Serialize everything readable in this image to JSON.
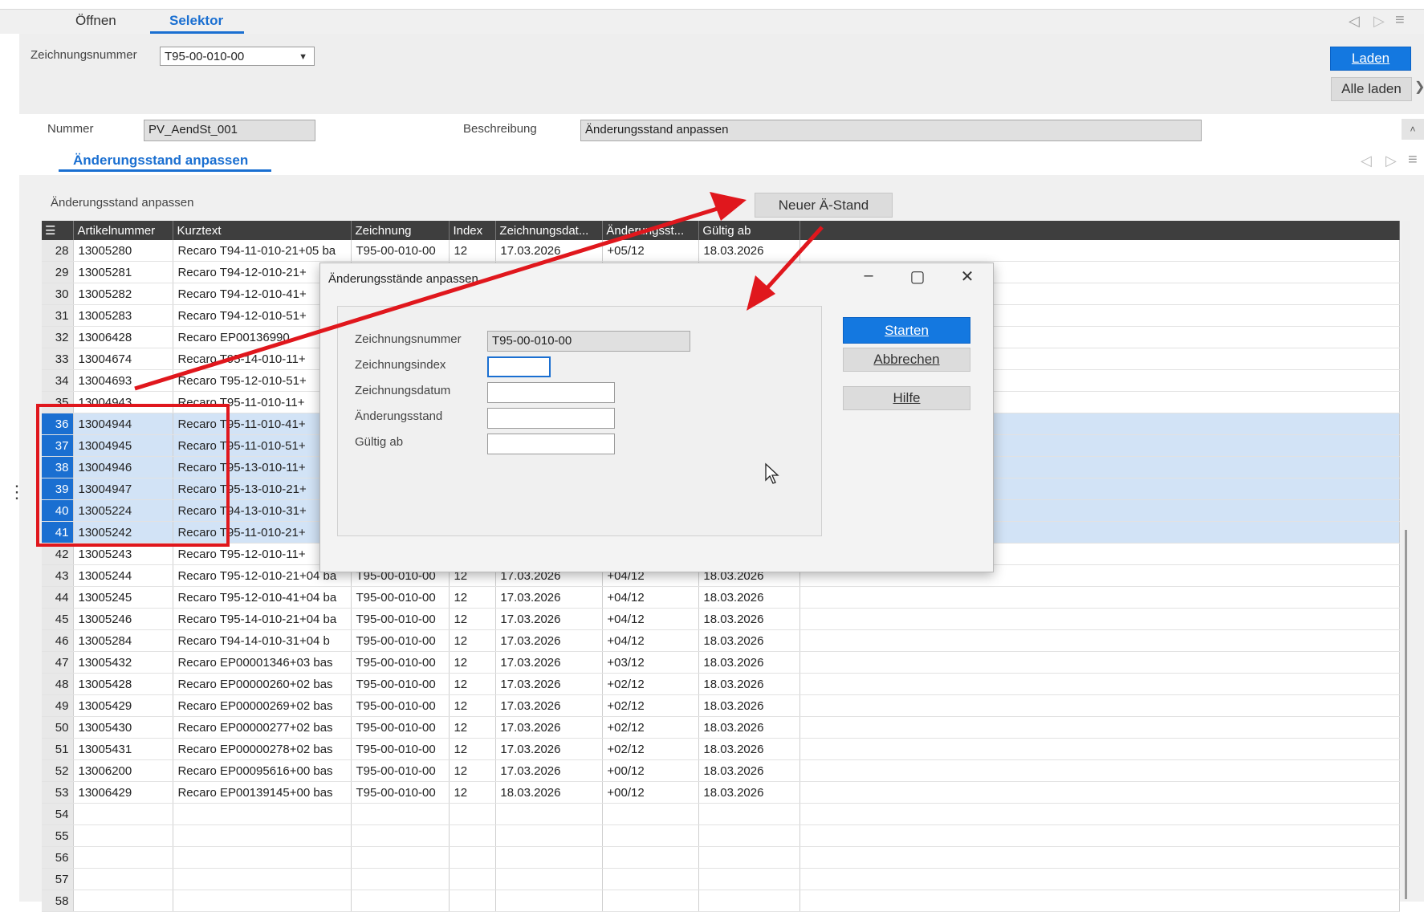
{
  "tabs": [
    {
      "label": "Öffnen",
      "active": false
    },
    {
      "label": "Selektor",
      "active": true
    }
  ],
  "header": {
    "drawing_number_label": "Zeichnungsnummer",
    "drawing_number_value": "T95-00-010-00",
    "load_button": "Laden",
    "load_all_button": "Alle laden"
  },
  "info": {
    "number_label": "Nummer",
    "number_value": "PV_AendSt_001",
    "description_label": "Beschreibung",
    "description_value": "Änderungsstand anpassen"
  },
  "subtab": {
    "label": "Änderungsstand anpassen"
  },
  "section": {
    "title": "Änderungsstand anpassen",
    "new_button": "Neuer Ä-Stand"
  },
  "grid": {
    "columns": [
      "Artikelnummer",
      "Kurztext",
      "Zeichnung",
      "Index",
      "Zeichnungsdat...",
      "Änderungsst...",
      "Gültig ab"
    ],
    "rows": [
      {
        "n": "28",
        "art": "13005280",
        "kurz": "Recaro T94-11-010-21+05 ba",
        "zeich": "T95-00-010-00",
        "idx": "12",
        "datum": "17.03.2026",
        "aend": "+05/12",
        "gueltig": "18.03.2026",
        "sel": false
      },
      {
        "n": "29",
        "art": "13005281",
        "kurz": "Recaro T94-12-010-21+",
        "zeich": "",
        "idx": "",
        "datum": "",
        "aend": "",
        "gueltig": "",
        "sel": false
      },
      {
        "n": "30",
        "art": "13005282",
        "kurz": "Recaro T94-12-010-41+",
        "zeich": "",
        "idx": "",
        "datum": "",
        "aend": "",
        "gueltig": "",
        "sel": false
      },
      {
        "n": "31",
        "art": "13005283",
        "kurz": "Recaro T94-12-010-51+",
        "zeich": "",
        "idx": "",
        "datum": "",
        "aend": "",
        "gueltig": "",
        "sel": false
      },
      {
        "n": "32",
        "art": "13006428",
        "kurz": "Recaro EP00136990",
        "zeich": "",
        "idx": "",
        "datum": "",
        "aend": "",
        "gueltig": "",
        "sel": false
      },
      {
        "n": "33",
        "art": "13004674",
        "kurz": "Recaro T95-14-010-11+",
        "zeich": "",
        "idx": "",
        "datum": "",
        "aend": "",
        "gueltig": "",
        "sel": false
      },
      {
        "n": "34",
        "art": "13004693",
        "kurz": "Recaro T95-12-010-51+",
        "zeich": "",
        "idx": "",
        "datum": "",
        "aend": "",
        "gueltig": "",
        "sel": false
      },
      {
        "n": "35",
        "art": "13004943",
        "kurz": "Recaro T95-11-010-11+",
        "zeich": "",
        "idx": "",
        "datum": "",
        "aend": "",
        "gueltig": "",
        "sel": false
      },
      {
        "n": "36",
        "art": "13004944",
        "kurz": "Recaro T95-11-010-41+",
        "zeich": "",
        "idx": "",
        "datum": "",
        "aend": "",
        "gueltig": "",
        "sel": true
      },
      {
        "n": "37",
        "art": "13004945",
        "kurz": "Recaro T95-11-010-51+",
        "zeich": "",
        "idx": "",
        "datum": "",
        "aend": "",
        "gueltig": "",
        "sel": true
      },
      {
        "n": "38",
        "art": "13004946",
        "kurz": "Recaro T95-13-010-11+",
        "zeich": "",
        "idx": "",
        "datum": "",
        "aend": "",
        "gueltig": "",
        "sel": true
      },
      {
        "n": "39",
        "art": "13004947",
        "kurz": "Recaro T95-13-010-21+",
        "zeich": "",
        "idx": "",
        "datum": "",
        "aend": "",
        "gueltig": "",
        "sel": true
      },
      {
        "n": "40",
        "art": "13005224",
        "kurz": "Recaro T94-13-010-31+",
        "zeich": "",
        "idx": "",
        "datum": "",
        "aend": "",
        "gueltig": "",
        "sel": true
      },
      {
        "n": "41",
        "art": "13005242",
        "kurz": "Recaro T95-11-010-21+",
        "zeich": "",
        "idx": "",
        "datum": "",
        "aend": "",
        "gueltig": "",
        "sel": true
      },
      {
        "n": "42",
        "art": "13005243",
        "kurz": "Recaro T95-12-010-11+",
        "zeich": "",
        "idx": "",
        "datum": "",
        "aend": "",
        "gueltig": "",
        "sel": false
      },
      {
        "n": "43",
        "art": "13005244",
        "kurz": "Recaro T95-12-010-21+04 ba",
        "zeich": "T95-00-010-00",
        "idx": "12",
        "datum": "17.03.2026",
        "aend": "+04/12",
        "gueltig": "18.03.2026",
        "sel": false
      },
      {
        "n": "44",
        "art": "13005245",
        "kurz": "Recaro T95-12-010-41+04 ba",
        "zeich": "T95-00-010-00",
        "idx": "12",
        "datum": "17.03.2026",
        "aend": "+04/12",
        "gueltig": "18.03.2026",
        "sel": false
      },
      {
        "n": "45",
        "art": "13005246",
        "kurz": "Recaro T95-14-010-21+04 ba",
        "zeich": "T95-00-010-00",
        "idx": "12",
        "datum": "17.03.2026",
        "aend": "+04/12",
        "gueltig": "18.03.2026",
        "sel": false
      },
      {
        "n": "46",
        "art": "13005284",
        "kurz": "Recaro T94-14-010-31+04  b",
        "zeich": "T95-00-010-00",
        "idx": "12",
        "datum": "17.03.2026",
        "aend": "+04/12",
        "gueltig": "18.03.2026",
        "sel": false
      },
      {
        "n": "47",
        "art": "13005432",
        "kurz": "Recaro EP00001346+03 bas",
        "zeich": "T95-00-010-00",
        "idx": "12",
        "datum": "17.03.2026",
        "aend": "+03/12",
        "gueltig": "18.03.2026",
        "sel": false
      },
      {
        "n": "48",
        "art": "13005428",
        "kurz": "Recaro EP00000260+02 bas",
        "zeich": "T95-00-010-00",
        "idx": "12",
        "datum": "17.03.2026",
        "aend": "+02/12",
        "gueltig": "18.03.2026",
        "sel": false
      },
      {
        "n": "49",
        "art": "13005429",
        "kurz": "Recaro EP00000269+02 bas",
        "zeich": "T95-00-010-00",
        "idx": "12",
        "datum": "17.03.2026",
        "aend": "+02/12",
        "gueltig": "18.03.2026",
        "sel": false
      },
      {
        "n": "50",
        "art": "13005430",
        "kurz": "Recaro EP00000277+02 bas",
        "zeich": "T95-00-010-00",
        "idx": "12",
        "datum": "17.03.2026",
        "aend": "+02/12",
        "gueltig": "18.03.2026",
        "sel": false
      },
      {
        "n": "51",
        "art": "13005431",
        "kurz": "Recaro EP00000278+02 bas",
        "zeich": "T95-00-010-00",
        "idx": "12",
        "datum": "17.03.2026",
        "aend": "+02/12",
        "gueltig": "18.03.2026",
        "sel": false
      },
      {
        "n": "52",
        "art": "13006200",
        "kurz": "Recaro EP00095616+00 bas",
        "zeich": "T95-00-010-00",
        "idx": "12",
        "datum": "17.03.2026",
        "aend": "+00/12",
        "gueltig": "18.03.2026",
        "sel": false
      },
      {
        "n": "53",
        "art": "13006429",
        "kurz": "Recaro EP00139145+00 bas",
        "zeich": "T95-00-010-00",
        "idx": "12",
        "datum": "18.03.2026",
        "aend": "+00/12",
        "gueltig": "18.03.2026",
        "sel": false
      },
      {
        "n": "54",
        "art": "",
        "kurz": "",
        "zeich": "",
        "idx": "",
        "datum": "",
        "aend": "",
        "gueltig": "",
        "sel": false
      },
      {
        "n": "55",
        "art": "",
        "kurz": "",
        "zeich": "",
        "idx": "",
        "datum": "",
        "aend": "",
        "gueltig": "",
        "sel": false
      },
      {
        "n": "56",
        "art": "",
        "kurz": "",
        "zeich": "",
        "idx": "",
        "datum": "",
        "aend": "",
        "gueltig": "",
        "sel": false
      },
      {
        "n": "57",
        "art": "",
        "kurz": "",
        "zeich": "",
        "idx": "",
        "datum": "",
        "aend": "",
        "gueltig": "",
        "sel": false
      },
      {
        "n": "58",
        "art": "",
        "kurz": "",
        "zeich": "",
        "idx": "",
        "datum": "",
        "aend": "",
        "gueltig": "",
        "sel": false
      }
    ]
  },
  "dialog": {
    "title": "Änderungsstände anpassen",
    "fields": {
      "zeichnungsnummer_label": "Zeichnungsnummer",
      "zeichnungsnummer_value": "T95-00-010-00",
      "zeichnungsindex_label": "Zeichnungsindex",
      "zeichnungsindex_value": "",
      "zeichnungsdatum_label": "Zeichnungsdatum",
      "zeichnungsdatum_value": "",
      "aenderungsstand_label": "Änderungsstand",
      "aenderungsstand_value": "",
      "gueltig_ab_label": "Gültig ab",
      "gueltig_ab_value": ""
    },
    "buttons": {
      "start": "Starten",
      "cancel": "Abbrechen",
      "help": "Hilfe"
    },
    "window": {
      "minimize": "–",
      "maximize": "▢",
      "close": "✕"
    }
  },
  "icons": {
    "nav_prev": "◁",
    "nav_next": "▷",
    "menu": "≡",
    "dropdown": "▼",
    "grid_menu": "☰",
    "more": "⋮",
    "collapse": "˄",
    "chevron": "❯"
  },
  "colors": {
    "accent": "#1478e0",
    "annotation_red": "#e0171d",
    "selection": "#d2e3f6"
  }
}
